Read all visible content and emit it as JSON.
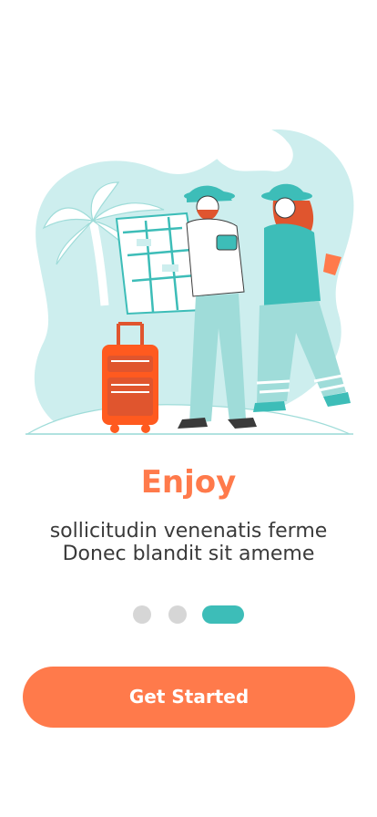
{
  "onboarding": {
    "title": "Enjoy",
    "subtitle_line1": "sollicitudin venenatis ferme",
    "subtitle_line2": "Donec blandit sit ameme",
    "cta_label": "Get Started"
  },
  "pagination": {
    "total": 3,
    "active_index": 2
  },
  "colors": {
    "accent": "#FF7A4B",
    "teal": "#3DBDB8",
    "teal_light": "#CDEEEE",
    "dot_inactive": "#D6D6D6"
  },
  "illustration": {
    "subject": "travel-couple-with-map-and-suitcase"
  }
}
